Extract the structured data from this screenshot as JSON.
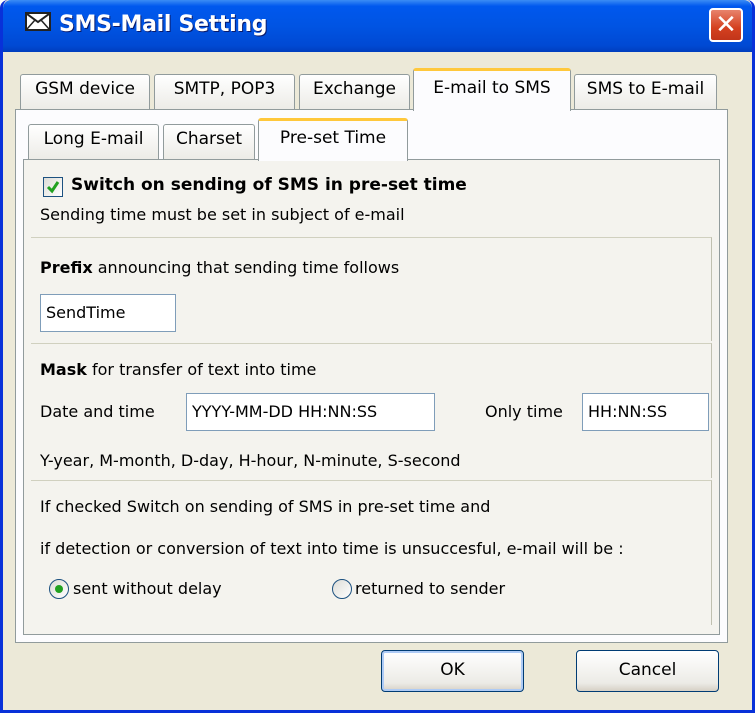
{
  "window": {
    "title": "SMS-Mail Setting",
    "title_icon": "envelope-icon",
    "close_symbol": "✕"
  },
  "main_tabs": [
    {
      "label": "GSM device"
    },
    {
      "label": "SMTP, POP3"
    },
    {
      "label": "Exchange"
    },
    {
      "label": "E-mail to SMS",
      "active": true
    },
    {
      "label": "SMS to E-mail"
    }
  ],
  "sub_tabs": [
    {
      "label": "Long E-mail"
    },
    {
      "label": "Charset"
    },
    {
      "label": "Pre-set Time",
      "active": true
    }
  ],
  "switch_section": {
    "checkbox_checked": true,
    "checkbox_label": "Switch on sending of SMS in pre-set time",
    "note": "Sending time must be set in subject of e-mail"
  },
  "prefix_section": {
    "label_bold": "Prefix",
    "label_rest": " announcing that sending time follows",
    "value": "SendTime"
  },
  "mask_section": {
    "label_bold": "Mask",
    "label_rest": " for transfer of text into time",
    "date_time_label": "Date and time",
    "date_time_value": "YYYY-MM-DD HH:NN:SS",
    "only_time_label": "Only time",
    "only_time_value": "HH:NN:SS",
    "legend": "Y-year, M-month, D-day, H-hour, N-minute, S-second"
  },
  "failure_section": {
    "line1": "If checked Switch on sending of SMS in pre-set time and",
    "line2": "if detection or conversion of text into time is unsuccesful, e-mail will be :",
    "options": [
      {
        "label": "sent without delay",
        "selected": true
      },
      {
        "label": "returned to sender",
        "selected": false
      }
    ]
  },
  "buttons": {
    "ok": "OK",
    "cancel": "Cancel"
  },
  "colors": {
    "title_bar": "#0054e3",
    "close": "#d4401f",
    "active_tab_accent": "#ffc83c",
    "radio_dot": "#21a121",
    "check_mark": "#21a121"
  }
}
